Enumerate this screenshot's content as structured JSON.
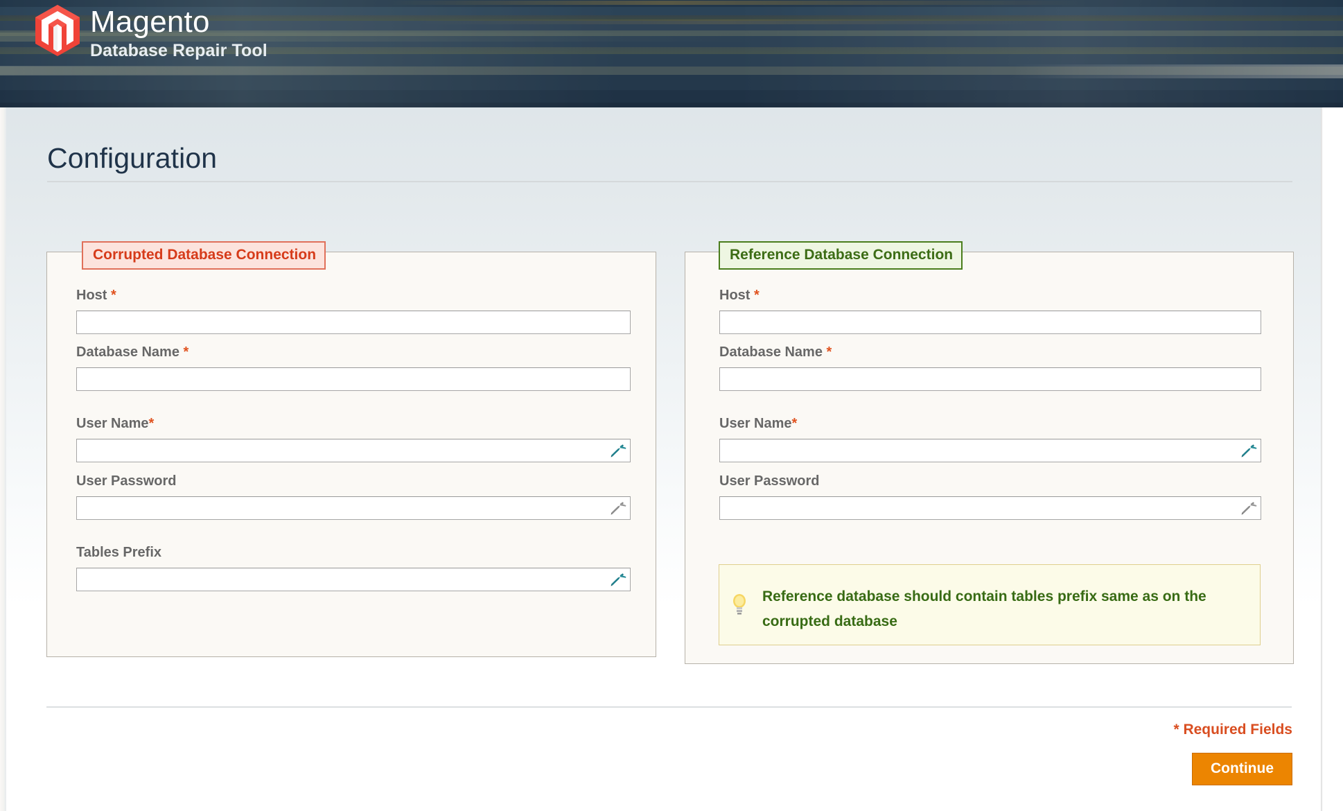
{
  "header": {
    "brand_title": "Magento",
    "brand_subtitle": "Database Repair Tool",
    "logo_icon": "magento-hexagon-logo"
  },
  "page": {
    "title": "Configuration"
  },
  "corrupted_panel": {
    "legend": "Corrupted Database Connection",
    "legend_color": "#d63b1a",
    "fields": [
      {
        "label": "Host",
        "required_mark": " *",
        "value": "",
        "placeholder": "",
        "icon": ""
      },
      {
        "label": "Database Name",
        "required_mark": " *",
        "value": "",
        "placeholder": "",
        "icon": ""
      },
      {
        "label": "User Name",
        "required_mark": "*",
        "value": "",
        "placeholder": "",
        "icon": "wrench-icon-teal"
      },
      {
        "label": "User Password",
        "required_mark": "",
        "value": "",
        "placeholder": "",
        "icon": "wrench-icon-gray"
      },
      {
        "label": "Tables Prefix",
        "required_mark": "",
        "value": "",
        "placeholder": "",
        "icon": "wrench-icon-teal"
      }
    ]
  },
  "reference_panel": {
    "legend": "Reference Database Connection",
    "legend_color": "#3c6c15",
    "fields": [
      {
        "label": "Host",
        "required_mark": " *",
        "value": "",
        "placeholder": "",
        "icon": ""
      },
      {
        "label": "Database Name",
        "required_mark": " *",
        "value": "",
        "placeholder": "",
        "icon": ""
      },
      {
        "label": "User Name",
        "required_mark": "*",
        "value": "",
        "placeholder": "",
        "icon": "wrench-icon-teal"
      },
      {
        "label": "User Password",
        "required_mark": "",
        "value": "",
        "placeholder": "",
        "icon": "wrench-icon-gray"
      }
    ],
    "notice": {
      "icon": "lightbulb-icon",
      "text": "Reference database should contain tables prefix same as on the corrupted database",
      "text_color": "#386b14"
    }
  },
  "footer": {
    "required_fields_note": "* Required Fields",
    "continue_label": "Continue",
    "continue_color": "#ec8501"
  }
}
